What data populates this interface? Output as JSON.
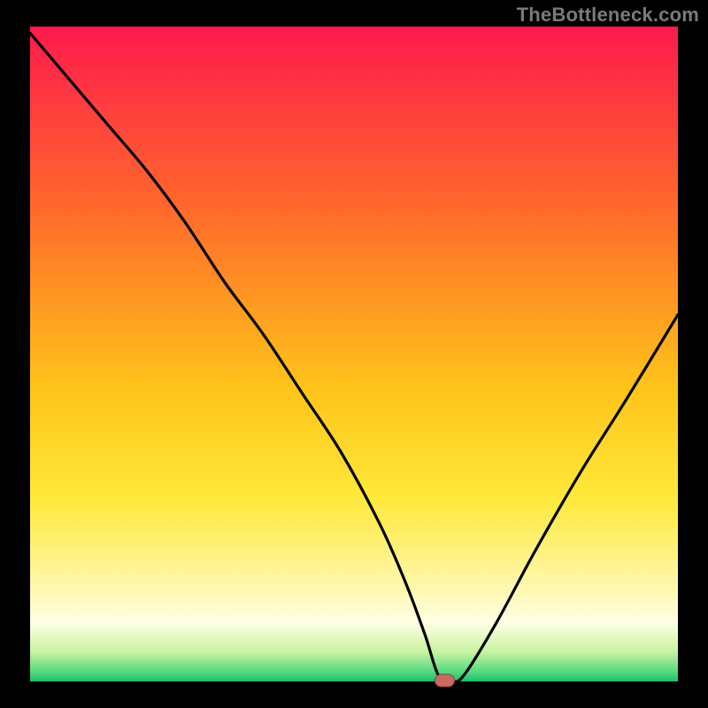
{
  "watermark": "TheBottleneck.com",
  "chart_data": {
    "type": "line",
    "title": "",
    "xlabel": "",
    "ylabel": "",
    "xlim": [
      0,
      100
    ],
    "ylim_bottleneck": [
      0,
      100
    ],
    "notes": "V-shaped bottleneck curve over a vertical red→orange→yellow→green gradient. Minimum (optimal point) marked by a small red pill near x≈64, y≈0. No axis tick labels are shown.",
    "series": [
      {
        "name": "bottleneck-curve",
        "x": [
          0,
          6,
          12,
          18,
          24,
          30,
          36,
          42,
          48,
          54,
          58,
          61,
          63,
          65,
          67,
          72,
          78,
          85,
          92,
          100
        ],
        "values": [
          99,
          92,
          85,
          78,
          70,
          61,
          53,
          44,
          35,
          24,
          15,
          7,
          1,
          0,
          1,
          9,
          20,
          32,
          43,
          56
        ]
      }
    ],
    "optimal_point": {
      "x": 64,
      "y": 0
    },
    "gradient_stops": [
      {
        "offset": 0.0,
        "color": "#ff1a4d"
      },
      {
        "offset": 0.28,
        "color": "#ff6a2b"
      },
      {
        "offset": 0.55,
        "color": "#ffc31a"
      },
      {
        "offset": 0.72,
        "color": "#ffe93a"
      },
      {
        "offset": 0.86,
        "color": "#fff8b0"
      },
      {
        "offset": 0.91,
        "color": "#ffffe5"
      },
      {
        "offset": 0.955,
        "color": "#c8f3a1"
      },
      {
        "offset": 0.985,
        "color": "#56d97f"
      },
      {
        "offset": 1.0,
        "color": "#19c06a"
      }
    ],
    "colors": {
      "curve": "#000000",
      "marker_fill": "#c96a62",
      "marker_stroke": "#8a3e38",
      "frame": "#000000"
    }
  }
}
